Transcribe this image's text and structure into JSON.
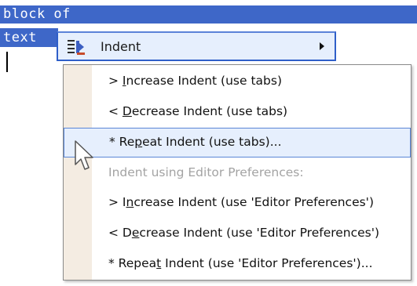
{
  "editor": {
    "line1": "block of",
    "line2": "text"
  },
  "menu": {
    "parent": {
      "label": "Indent",
      "icon": "indent-icon"
    },
    "items": [
      {
        "prefix": "> ",
        "mnemonic": "I",
        "rest": "ncrease Indent (use tabs)",
        "full": "> Increase Indent (use tabs)",
        "enabled": true,
        "highlighted": false
      },
      {
        "prefix": "< ",
        "mnemonic": "D",
        "rest": "ecrease Indent (use tabs)",
        "full": "< Decrease Indent (use tabs)",
        "enabled": true,
        "highlighted": false
      },
      {
        "prefix": "* Re",
        "mnemonic": "p",
        "rest": "eat Indent (use tabs)...",
        "full": "* Repeat Indent (use tabs)...",
        "enabled": true,
        "highlighted": true
      },
      {
        "prefix": "",
        "mnemonic": "",
        "rest": "Indent using Editor Preferences:",
        "full": "Indent using Editor Preferences:",
        "enabled": false,
        "highlighted": false
      },
      {
        "prefix": "> I",
        "mnemonic": "n",
        "rest": "crease Indent (use 'Editor Preferences')",
        "full": "> Increase Indent (use 'Editor Preferences')",
        "enabled": true,
        "highlighted": false
      },
      {
        "prefix": "< D",
        "mnemonic": "e",
        "rest": "crease Indent (use 'Editor Preferences')",
        "full": "< Decrease Indent (use 'Editor Preferences')",
        "enabled": true,
        "highlighted": false
      },
      {
        "prefix": "* Repea",
        "mnemonic": "t",
        "rest": " Indent (use 'Editor Preferences')...",
        "full": "* Repeat Indent (use 'Editor Preferences')...",
        "enabled": true,
        "highlighted": false
      }
    ]
  },
  "colors": {
    "selection": "#3e67c8",
    "highlight_bg": "#e6effd",
    "highlight_border": "#5a86d6",
    "gutter": "#f4ece2",
    "disabled_text": "#a3a3a3"
  }
}
